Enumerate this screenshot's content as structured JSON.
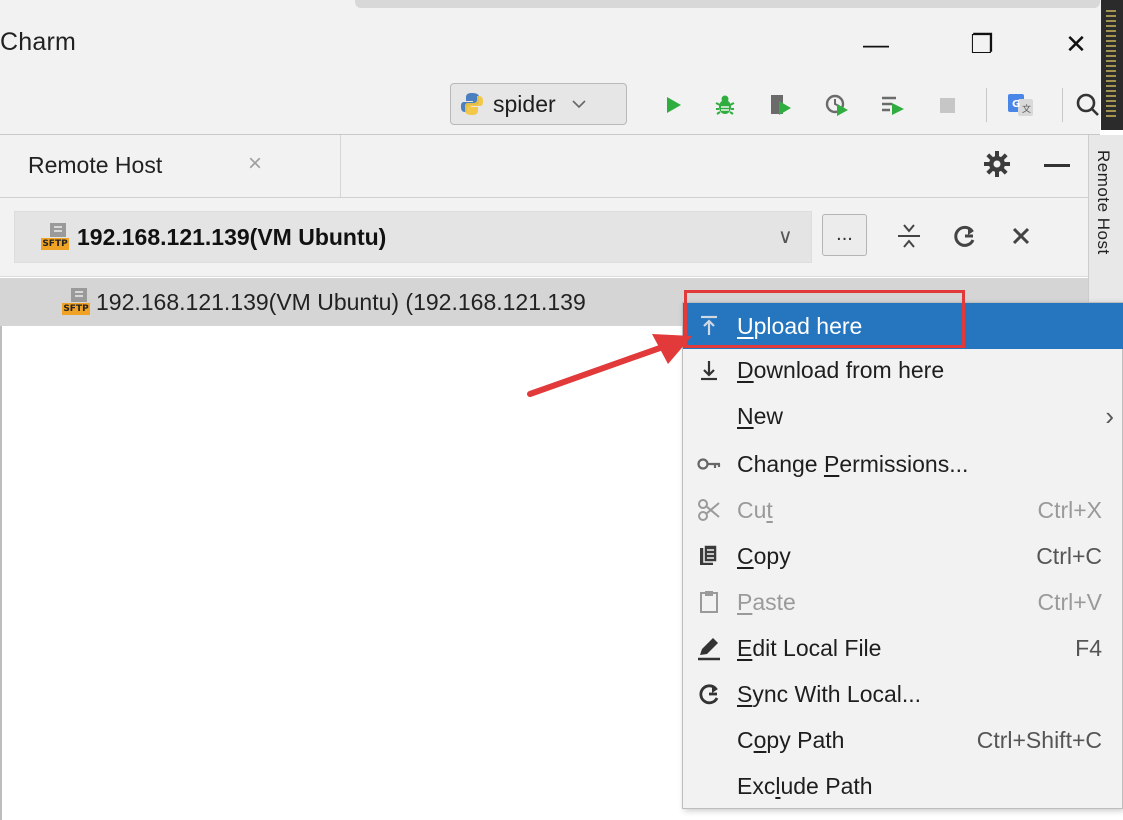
{
  "window": {
    "title": "Charm",
    "minimize_glyph": "—",
    "restore_glyph": "❐",
    "close_glyph": "✕"
  },
  "toolbar": {
    "run_config_label": "spider",
    "icons": [
      "python-icon",
      "run-icon",
      "debug-icon",
      "coverage-icon",
      "profile-icon",
      "concurrency-icon",
      "stop-icon",
      "translate-icon",
      "search-icon"
    ]
  },
  "tool_window": {
    "tab_label": "Remote Host",
    "tab_close_glyph": "×",
    "side_stripe_label": "Remote Host"
  },
  "host_selector": {
    "selected_host": "192.168.121.139(VM Ubuntu)",
    "more_button_label": "...",
    "dropdown_glyph": "∨"
  },
  "tree": {
    "root_label": "192.168.121.139(VM Ubuntu) (192.168.121.139"
  },
  "context_menu": {
    "items": [
      {
        "pre": "",
        "mn": "U",
        "post": "pload here",
        "shortcut": "",
        "icon": "upload-icon",
        "selected": true,
        "disabled": true
      },
      {
        "pre": "",
        "mn": "D",
        "post": "ownload from here",
        "shortcut": "",
        "icon": "download-icon",
        "selected": false,
        "disabled": false
      },
      {
        "pre": "",
        "mn": "N",
        "post": "ew",
        "shortcut": "",
        "icon": "",
        "submenu_glyph": "›",
        "selected": false,
        "disabled": false
      },
      {
        "pre": "Change ",
        "mn": "P",
        "post": "ermissions...",
        "shortcut": "",
        "icon": "key-icon",
        "selected": false,
        "disabled": false
      },
      {
        "pre": "Cu",
        "mn": "t",
        "post": "",
        "shortcut": "Ctrl+X",
        "icon": "scissors-icon",
        "selected": false,
        "disabled": true
      },
      {
        "pre": "",
        "mn": "C",
        "post": "opy",
        "shortcut": "Ctrl+C",
        "icon": "copy-icon",
        "selected": false,
        "disabled": false
      },
      {
        "pre": "",
        "mn": "P",
        "post": "aste",
        "shortcut": "Ctrl+V",
        "icon": "paste-icon",
        "selected": false,
        "disabled": true
      },
      {
        "pre": "",
        "mn": "E",
        "post": "dit Local File",
        "shortcut": "F4",
        "icon": "edit-icon",
        "selected": false,
        "disabled": false
      },
      {
        "pre": "",
        "mn": "S",
        "post": "ync With Local...",
        "shortcut": "",
        "icon": "sync-icon",
        "selected": false,
        "disabled": false
      },
      {
        "pre": "C",
        "mn": "o",
        "post": "py Path",
        "shortcut": "Ctrl+Shift+C",
        "icon": "",
        "selected": false,
        "disabled": false
      },
      {
        "pre": "Exc",
        "mn": "l",
        "post": "ude Path",
        "shortcut": "",
        "icon": "",
        "selected": false,
        "disabled": false
      }
    ]
  },
  "colors": {
    "selection": "#2675bf",
    "annotation": "#e23a3a",
    "run_green": "#2fae3f",
    "sftp_orange": "#f0a224"
  }
}
